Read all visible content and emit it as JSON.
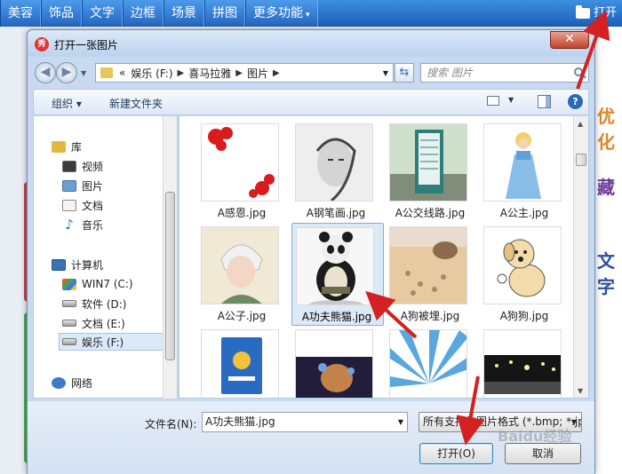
{
  "app": {
    "tabs": [
      "美容",
      "饰品",
      "文字",
      "边框",
      "场景",
      "拼图",
      "更多功能"
    ],
    "open_label": "打开",
    "right_text": [
      "优化",
      "藏",
      "文字"
    ]
  },
  "dialog": {
    "title": "打开一张图片",
    "close_glyph": "✕",
    "breadcrumb": [
      "«",
      "娱乐 (F:)",
      "喜马拉雅",
      "图片"
    ],
    "search_placeholder": "搜索 图片",
    "commands": {
      "organize": "组织 ▾",
      "new_folder": "新建文件夹"
    },
    "nav": {
      "items": [
        {
          "label": "库",
          "icon": "library-icon"
        },
        {
          "label": "视频",
          "icon": "video-icon"
        },
        {
          "label": "图片",
          "icon": "pictures-icon"
        },
        {
          "label": "文档",
          "icon": "documents-icon"
        },
        {
          "label": "音乐",
          "icon": "music-icon"
        },
        {
          "label": "计算机",
          "icon": "computer-icon"
        },
        {
          "label": "WIN7 (C:)",
          "icon": "windows-drive-icon"
        },
        {
          "label": "软件 (D:)",
          "icon": "drive-icon"
        },
        {
          "label": "文档 (E:)",
          "icon": "drive-icon"
        },
        {
          "label": "娱乐 (F:)",
          "icon": "drive-icon"
        },
        {
          "label": "网络",
          "icon": "network-icon"
        }
      ]
    },
    "files": [
      {
        "name": "A感恩.jpg"
      },
      {
        "name": "A钢笔画.jpg"
      },
      {
        "name": "A公交线路.jpg"
      },
      {
        "name": "A公主.jpg"
      },
      {
        "name": "A公子.jpg"
      },
      {
        "name": "A功夫熊猫.jpg"
      },
      {
        "name": "A狗被埋.jpg"
      },
      {
        "name": "A狗狗.jpg"
      },
      {
        "name": ""
      },
      {
        "name": ""
      },
      {
        "name": ""
      },
      {
        "name": ""
      }
    ],
    "filename_label": "文件名(N):",
    "filename_value": "A功夫熊猫.jpg",
    "filetype_value": "所有支持的图片格式 (*.bmp; *.jp",
    "open_button": "打开(O)",
    "cancel_button": "取消"
  },
  "watermark": "Baidu经验"
}
